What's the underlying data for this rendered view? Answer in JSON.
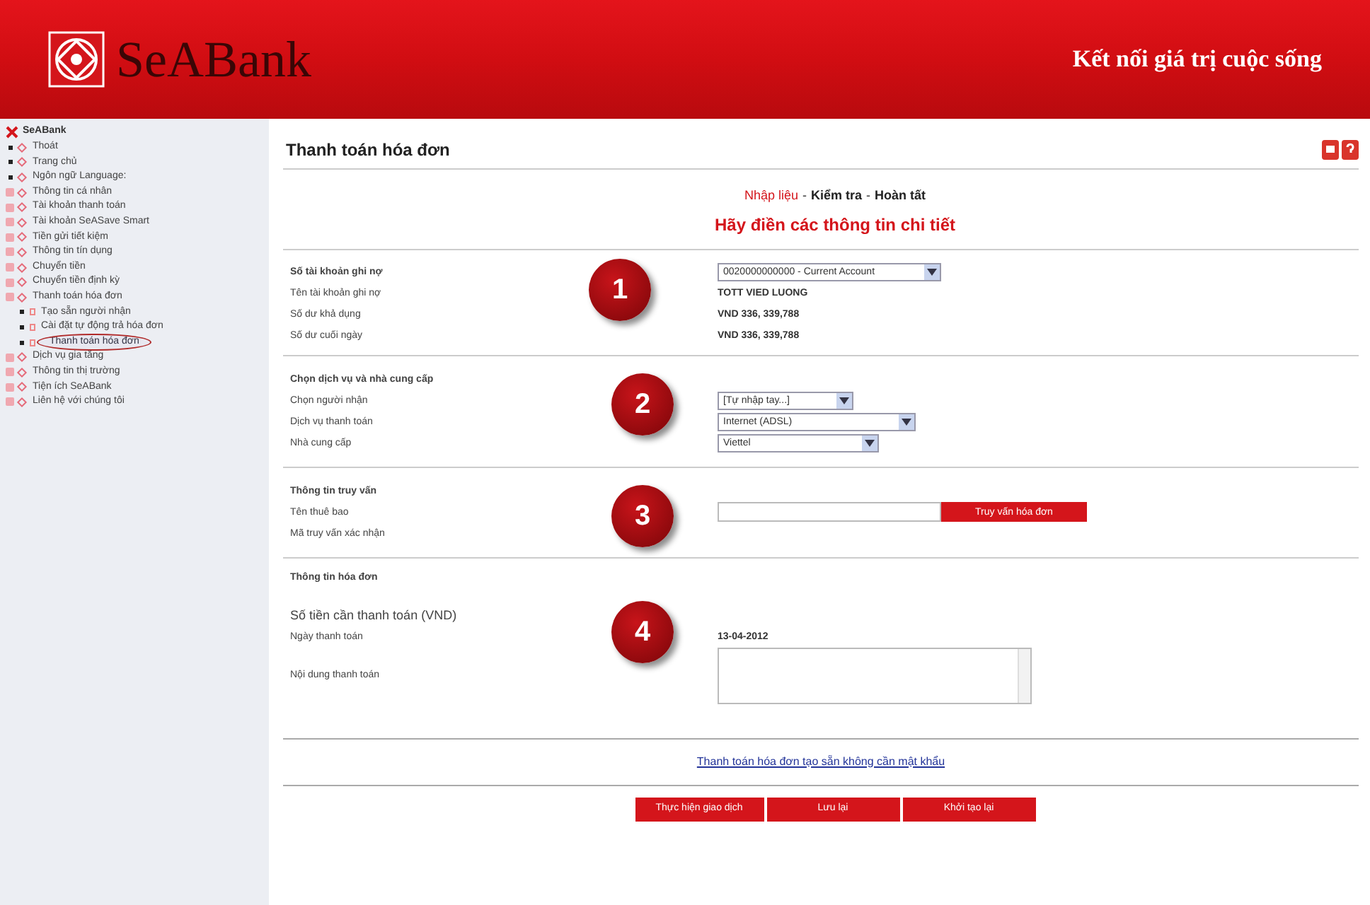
{
  "header": {
    "logo_text": "SeABank",
    "tagline": "Kết nối giá trị cuộc sống"
  },
  "sidebar": {
    "root": "SeABank",
    "items": [
      {
        "label": "Thoát",
        "kind": "leaf",
        "selected": false
      },
      {
        "label": "Trang chủ",
        "kind": "leaf",
        "selected": false
      },
      {
        "label": "Ngôn ngữ Language:",
        "kind": "leaf",
        "selected": false
      },
      {
        "label": "Thông tin cá nhân",
        "kind": "folder",
        "selected": false
      },
      {
        "label": "Tài khoản thanh toán",
        "kind": "folder",
        "selected": false
      },
      {
        "label": "Tài khoản SeASave Smart",
        "kind": "folder",
        "selected": false
      },
      {
        "label": "Tiền gửi tiết kiệm",
        "kind": "folder",
        "selected": false
      },
      {
        "label": "Thông tin tín dụng",
        "kind": "folder",
        "selected": false
      },
      {
        "label": "Chuyển tiền",
        "kind": "folder",
        "selected": false
      },
      {
        "label": "Chuyển tiền định kỳ",
        "kind": "folder",
        "selected": false
      },
      {
        "label": "Thanh toán hóa đơn",
        "kind": "folder",
        "selected": false,
        "children": [
          {
            "label": "Tạo sẵn người nhận",
            "kind": "leaf",
            "selected": false
          },
          {
            "label": "Cài đặt tự động trả hóa đơn",
            "kind": "leaf",
            "selected": false
          },
          {
            "label": "Thanh toán hóa đơn",
            "kind": "leaf",
            "selected": true
          }
        ]
      },
      {
        "label": "Dịch vụ gia tăng",
        "kind": "folder",
        "selected": false
      },
      {
        "label": "Thông tin thị trường",
        "kind": "folder",
        "selected": false
      },
      {
        "label": "Tiện ích SeABank",
        "kind": "folder",
        "selected": false
      },
      {
        "label": "Liên hệ với chúng tôi",
        "kind": "folder",
        "selected": false
      }
    ]
  },
  "page_title": "Thanh toán hóa đơn",
  "step_separator": "-",
  "steps": [
    {
      "label": "Nhập liệu",
      "selected": true
    },
    {
      "label": "Kiểm tra",
      "selected": false
    },
    {
      "label": "Hoàn tất",
      "selected": false
    }
  ],
  "subtitle": "Hãy điền các thông tin chi tiết",
  "sections": [
    {
      "badge": "1",
      "rows": [
        {
          "label": "Số tài khoản ghi nợ",
          "kind": "heading",
          "control": {
            "kind": "select",
            "value": "0020000000000 - Current Account"
          }
        },
        {
          "label": "Tên tài khoản ghi nợ",
          "kind": "field",
          "control": {
            "kind": "text",
            "value": "TOTT VIED LUONG"
          }
        },
        {
          "label": "Số dư khả dụng",
          "kind": "field",
          "control": {
            "kind": "text",
            "value": "VND 336, 339,788"
          }
        },
        {
          "label": "Số dư cuối ngày",
          "kind": "field",
          "control": {
            "kind": "text",
            "value": "VND 336, 339,788"
          }
        }
      ]
    },
    {
      "badge": "2",
      "rows": [
        {
          "label": "Chọn dịch vụ và nhà cung cấp",
          "kind": "heading"
        },
        {
          "label": "Chọn người nhận",
          "kind": "field",
          "control": {
            "kind": "select",
            "value": "[Tự nhập tay...]"
          }
        },
        {
          "label": "Dịch vụ thanh toán",
          "kind": "field",
          "control": {
            "kind": "select",
            "value": "Internet (ADSL)"
          }
        },
        {
          "label": "Nhà cung cấp",
          "kind": "field",
          "control": {
            "kind": "select",
            "value": "Viettel"
          }
        }
      ]
    },
    {
      "badge": "3",
      "rows": [
        {
          "label": "Thông tin truy vấn",
          "kind": "heading"
        },
        {
          "label": "Tên thuê bao",
          "kind": "field",
          "control": {
            "kind": "input_button",
            "button": "Truy vấn hóa đơn"
          }
        },
        {
          "label": "Mã truy vấn xác nhận",
          "kind": "field"
        }
      ]
    },
    {
      "badge": "4",
      "rows": [
        {
          "label": "Thông tin hóa đơn",
          "kind": "heading"
        },
        {
          "label": "Số tiền cần thanh toán (VND)",
          "kind": "amount"
        },
        {
          "label": "Ngày thanh toán",
          "kind": "field",
          "control": {
            "kind": "text",
            "value": "13-04-2012"
          }
        },
        {
          "label": "Nội dung thanh toán",
          "kind": "field",
          "control": {
            "kind": "textarea"
          }
        }
      ]
    }
  ],
  "link": "Thanh toán hóa đơn tạo sẵn không cần mật khẩu",
  "buttons": [
    "Thực hiện giao dịch",
    "Lưu lại",
    "Khởi tạo lại"
  ]
}
